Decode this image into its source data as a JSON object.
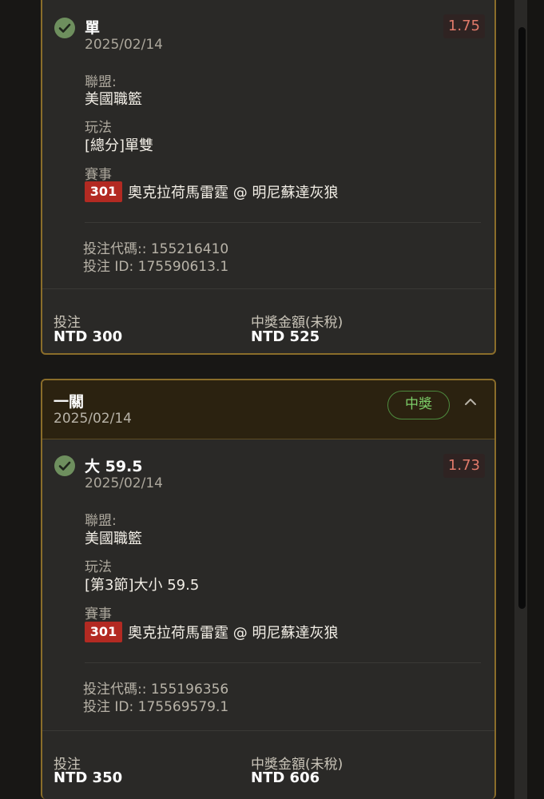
{
  "card1": {
    "leg": {
      "selection": "單",
      "date": "2025/02/14",
      "odds": "1.75",
      "league_label": "聯盟:",
      "league": "美國職籃",
      "market_label": "玩法",
      "market": "[總分]單雙",
      "event_label": "賽事",
      "game_no": "301",
      "match": "奧克拉荷馬雷霆 @ 明尼蘇達灰狼",
      "bet_code": "投注代碼:: 155216410",
      "bet_id": "投注 ID: 175590613.1"
    },
    "footer": {
      "stake_label": "投注",
      "stake": "NTD 300",
      "payout_label": "中獎金額(未稅)",
      "payout": "NTD 525"
    }
  },
  "card2": {
    "header": {
      "title": "一關",
      "date": "2025/02/14",
      "status": "中獎"
    },
    "leg": {
      "selection": "大 59.5",
      "date": "2025/02/14",
      "odds": "1.73",
      "league_label": "聯盟:",
      "league": "美國職籃",
      "market_label": "玩法",
      "market": "[第3節]大小 59.5",
      "event_label": "賽事",
      "game_no": "301",
      "match": "奧克拉荷馬雷霆 @ 明尼蘇達灰狼",
      "bet_code": "投注代碼:: 155196356",
      "bet_id": "投注 ID: 175569579.1"
    },
    "footer": {
      "stake_label": "投注",
      "stake": "NTD 350",
      "payout_label": "中獎金額(未稅)",
      "payout": "NTD 606"
    }
  },
  "icons": {
    "check": "check-circle-icon",
    "chevron": "chevron-up-icon"
  },
  "colors": {
    "card_border": "#8a6d2a",
    "win_green": "#7ccd68",
    "odds_red": "#e07a6a",
    "game_badge": "#b32a22"
  }
}
